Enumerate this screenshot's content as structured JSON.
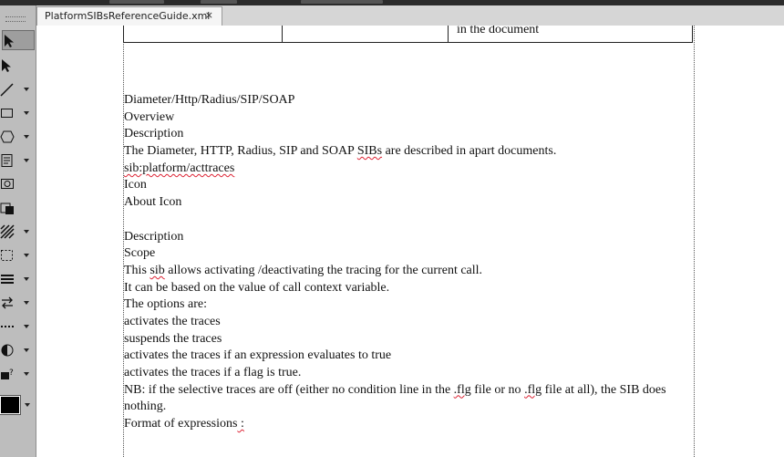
{
  "window": {
    "tab_title": "PlatformSIBsReferenceGuide.xml",
    "tab_close_glyph": "×"
  },
  "toolbar": {
    "tools": [
      {
        "name": "select-icon",
        "has_menu": false,
        "selected": true
      },
      {
        "name": "direct-select-icon",
        "has_menu": false
      },
      {
        "name": "line-icon",
        "has_menu": true
      },
      {
        "name": "rectangle-icon",
        "has_menu": true
      },
      {
        "name": "polygon-icon",
        "has_menu": true
      },
      {
        "name": "text-frame-icon",
        "has_menu": true
      },
      {
        "name": "image-frame-icon",
        "has_menu": false
      },
      {
        "name": "table-icon",
        "has_menu": false
      },
      {
        "name": "hatch-fill-icon",
        "has_menu": true
      },
      {
        "name": "marquee-icon",
        "has_menu": true
      },
      {
        "name": "align-icon",
        "has_menu": true
      },
      {
        "name": "swap-icon",
        "has_menu": true
      },
      {
        "name": "dotted-line-icon",
        "has_menu": true
      },
      {
        "name": "contrast-icon",
        "has_menu": true
      },
      {
        "name": "help-link-icon",
        "has_menu": true
      }
    ],
    "color_swatch": "#000000"
  },
  "document": {
    "table_cell_text": "in the document",
    "lines": [
      {
        "text": "Diameter/Http/Radius/SIP/SOAP"
      },
      {
        "text": "Overview"
      },
      {
        "text": "Description"
      },
      {
        "pre": "The Diameter, HTTP, Radius, SIP and SOAP ",
        "flag": "SIBs",
        "post": " are described in apart documents."
      },
      {
        "flag": "sib:platform/acttraces"
      },
      {
        "text": "Icon"
      },
      {
        "text": "About Icon"
      },
      {
        "gap": true
      },
      {
        "text": "Description"
      },
      {
        "text": "Scope"
      },
      {
        "pre": "This ",
        "flag": "sib",
        "post": " allows activating /deactivating the tracing for the current call."
      },
      {
        "text": "It can be based on the value of call context variable."
      },
      {
        "text": "The options are:"
      },
      {
        "text": "activates the traces"
      },
      {
        "text": "suspends the traces"
      },
      {
        "text": "activates the traces if an expression evaluates to true"
      },
      {
        "text": "activates the traces if a flag is true."
      },
      {
        "wrap": true,
        "pre": "NB: if the selective traces are off (either no condition line in the ",
        "flag": ".flg",
        "mid": " file or no ",
        "flag2": ".flg",
        "post": " file at all), the SIB does nothing."
      },
      {
        "pre": "Format of expressions",
        "flag": " :"
      }
    ]
  }
}
